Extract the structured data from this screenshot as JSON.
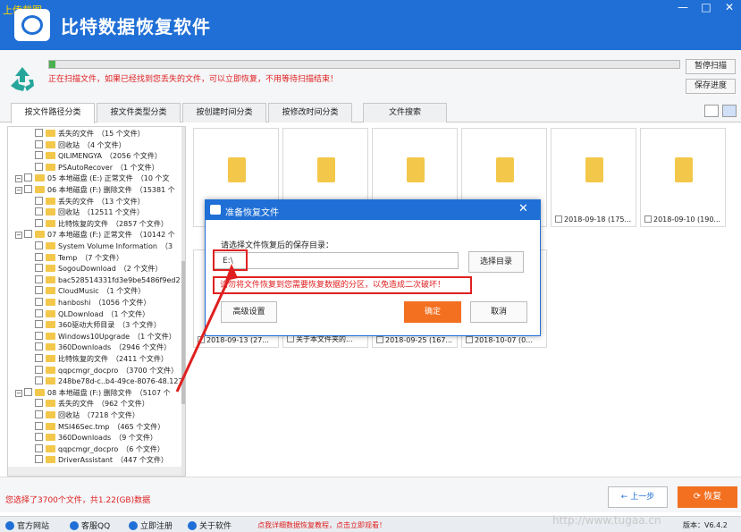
{
  "corner_text": "上传截图",
  "app": {
    "title": "比特数据恢复软件"
  },
  "window_controls": {
    "minimize": "—",
    "maximize": "□",
    "close": "✕"
  },
  "scan": {
    "progress": 0.01,
    "message": "正在扫描文件，如果已经找到您丢失的文件，可以立即恢复，不用等待扫描结束！",
    "pause_label": "暂停扫描",
    "save_label": "保存进度"
  },
  "tabs": [
    "按文件路径分类",
    "按文件类型分类",
    "按创建时间分类",
    "按修改时间分类",
    "文件搜索"
  ],
  "tree": [
    {
      "label": "丢失的文件",
      "count": "（15 个文件）"
    },
    {
      "label": "回收站",
      "count": "（4 个文件）"
    },
    {
      "label": "QILIMENGYA",
      "count": "（2056 个文件）"
    },
    {
      "label": "PSAutoRecover",
      "count": "（1 个文件）"
    },
    {
      "label": "05 本地磁盘 (E:) 正常文件",
      "count": "（10 个文"
    },
    {
      "label": "06 本地磁盘 (F:) 删除文件",
      "count": "（15381 个"
    },
    {
      "label": "丢失的文件",
      "count": "（13 个文件）"
    },
    {
      "label": "回收站",
      "count": "（12511 个文件）"
    },
    {
      "label": "比特恢复的文件",
      "count": "（2857 个文件）"
    },
    {
      "label": "07 本地磁盘 (F:) 正常文件",
      "count": "（10142 个"
    },
    {
      "label": "System Volume Information",
      "count": "（3"
    },
    {
      "label": "Temp",
      "count": "（7 个文件）"
    },
    {
      "label": "SogouDownload",
      "count": "（2 个文件）"
    },
    {
      "label": "bac528514331fd3e9be5486f9ed2",
      "count": ""
    },
    {
      "label": "CloudMusic",
      "count": "（1 个文件）"
    },
    {
      "label": "hanboshi",
      "count": "（1056 个文件）"
    },
    {
      "label": "QLDownload",
      "count": "（1 个文件）"
    },
    {
      "label": "360驱动大师目录",
      "count": "（3 个文件）"
    },
    {
      "label": "Windows10Upgrade",
      "count": "（1 个文件）"
    },
    {
      "label": "360Downloads",
      "count": "（2946 个文件）"
    },
    {
      "label": "比特恢复的文件",
      "count": "（2411 个文件）"
    },
    {
      "label": "qqpcmgr_docpro",
      "count": "（3700 个文件）"
    },
    {
      "label": "248be78d-c..b4-49ce-8076-48.127",
      "count": ""
    },
    {
      "label": "08 本地磁盘 (F:) 删除文件",
      "count": "（5107 个"
    },
    {
      "label": "丢失的文件",
      "count": "（962 个文件）"
    },
    {
      "label": "回收站",
      "count": "（7218 个文件）"
    },
    {
      "label": "MSI46Sec.tmp",
      "count": "（465 个文件）"
    },
    {
      "label": "360Downloads",
      "count": "（9 个文件）"
    },
    {
      "label": "qqpcmgr_docpro",
      "count": "（6 个文件）"
    },
    {
      "label": "DriverAssistant",
      "count": "（447 个文件）"
    }
  ],
  "cards_top": [
    "2018-09-18 (175...",
    "2018-09-10 (190..."
  ],
  "cards_bottom": [
    "2018-09-13 (27...",
    "关于本文件夹的...",
    "2018-09-25 (167...",
    "2018-10-07 (0..."
  ],
  "dialog": {
    "title": "准备恢复文件",
    "prompt": "请选择文件恢复后的保存目录：",
    "path_value": "E:\\",
    "choose_label": "选择目录",
    "warning": "请勿将文件恢复到您需要恢复数据的分区，以免造成二次破坏！",
    "advanced_label": "高级设置",
    "ok_label": "确定",
    "cancel_label": "取消"
  },
  "selection_info": "您选择了3700个文件，共1.22(GB)数据",
  "prev_label": "上一步",
  "recover_label": "恢复",
  "footer": {
    "links": [
      "官方网站",
      "客服QQ",
      "立即注册",
      "关于软件"
    ],
    "promo": "点我详细数据恢复教程，点击立即观看！",
    "watermark": "http://www.tugaa.cn",
    "version": "版本：V6.4.2"
  },
  "colors": {
    "titlebar": "#1f6fd6",
    "accent_orange": "#f37021",
    "warning_red": "#e02020",
    "folder": "#f3c74a"
  }
}
